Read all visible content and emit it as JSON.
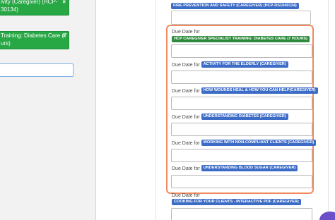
{
  "left": {
    "chip1": {
      "line1": "ivity (Caregiver) (HCP-",
      "line2": "30134)",
      "close": "×"
    },
    "chip2": {
      "line1": "Training: Diabetes Care (7",
      "line2": "urs)",
      "close": "×"
    }
  },
  "top_badge": "FIRE PREVENTION AND SAFETY (CAREGIVER) (HCP-DS1040134)",
  "fields": [
    {
      "prefix": "Due Date for",
      "badge": "HCP CAREGIVER SPECIALIST TRAINING: DIABETES CARE (7 HOURS)",
      "badge_style": "green"
    },
    {
      "prefix": "Due Date for",
      "badge": "ACTIVITY FOR THE ELDERLY (CAREGIVER)",
      "badge_style": "blue"
    },
    {
      "prefix": "Due Date for",
      "badge": "HOW WOUNDS HEAL & HOW YOU CAN HELP(CAREGIVER)",
      "badge_style": "blue"
    },
    {
      "prefix": "Due Date for",
      "badge": "UNDERSTANDING DIABETES (CAREGIVER)",
      "badge_style": "blue"
    },
    {
      "prefix": "Due Date for",
      "badge": "WORKING WITH NON-COMPLIANT CLIENTS (CAREGIVER)",
      "badge_style": "blue"
    },
    {
      "prefix": "Due Date for",
      "badge": "UNDERSTANDING BLOOD SUGAR (CAREGIVER)",
      "badge_style": "blue"
    },
    {
      "prefix": "Due Date for",
      "badge": "COOKING FOR YOUR CLIENTS - INTERACTIVE PDF (CAREGIVER)",
      "badge_style": "blue"
    }
  ],
  "colors": {
    "accent_blue": "#3d6cc6",
    "chip_green": "#28a745",
    "highlight_orange": "#f08a5d"
  }
}
